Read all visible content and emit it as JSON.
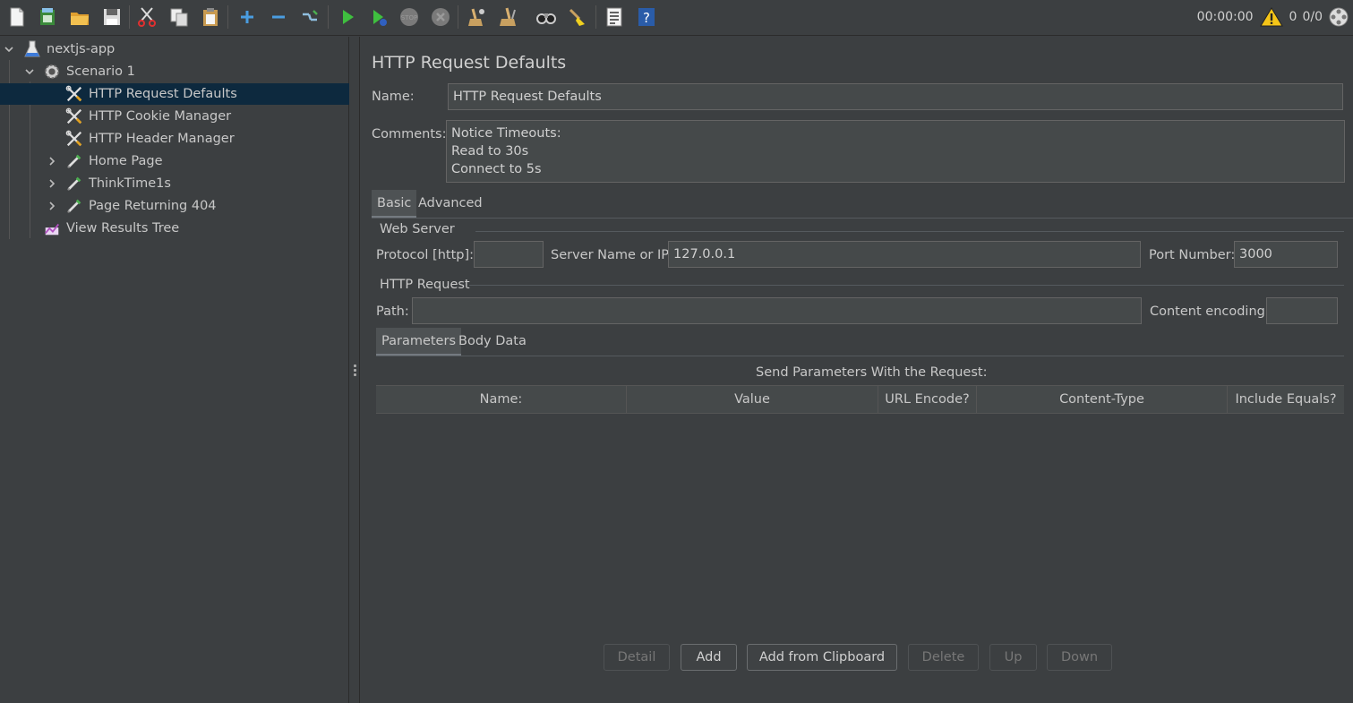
{
  "toolbar": {
    "icons": [
      "new-icon",
      "templates-icon",
      "open-icon",
      "save-icon",
      "cut-icon",
      "copy-icon",
      "paste-icon",
      "expand-icon",
      "collapse-icon",
      "toggle-icon",
      "start-icon",
      "start-no-pauses-icon",
      "stop-icon",
      "shutdown-icon",
      "clear-icon",
      "clear-all-icon",
      "search-icon",
      "reset-search-icon",
      "function-helper-icon",
      "help-icon"
    ],
    "timer": "00:00:00",
    "warnings": "0",
    "threads": "0/0"
  },
  "tree": {
    "items": [
      {
        "label": "nextjs-app",
        "icon": "test-plan-icon"
      },
      {
        "label": "Scenario 1",
        "icon": "thread-group-icon"
      },
      {
        "label": "HTTP Request Defaults",
        "icon": "config-element-icon"
      },
      {
        "label": "HTTP Cookie Manager",
        "icon": "config-element-icon"
      },
      {
        "label": "HTTP Header Manager",
        "icon": "config-element-icon"
      },
      {
        "label": "Home Page",
        "icon": "sampler-icon"
      },
      {
        "label": "ThinkTime1s",
        "icon": "sampler-icon"
      },
      {
        "label": "Page Returning 404",
        "icon": "sampler-icon"
      },
      {
        "label": "View Results Tree",
        "icon": "listener-icon"
      }
    ]
  },
  "main": {
    "title": "HTTP Request Defaults",
    "name_label": "Name:",
    "name_value": "HTTP Request Defaults",
    "comments_label": "Comments:",
    "comments_lines": [
      "Notice Timeouts:",
      "Read to 30s",
      "Connect to 5s"
    ],
    "tabs": [
      "Basic",
      "Advanced"
    ],
    "web_server": {
      "section": "Web Server",
      "protocol_label": "Protocol [http]:",
      "protocol_value": "",
      "server_label": "Server Name or IP:",
      "server_value": "127.0.0.1",
      "port_label": "Port Number:",
      "port_value": "3000"
    },
    "http_request": {
      "section": "HTTP Request",
      "path_label": "Path:",
      "path_value": "",
      "encoding_label": "Content encoding:",
      "encoding_value": ""
    },
    "sub_tabs": [
      "Parameters",
      "Body Data"
    ],
    "params_caption": "Send Parameters With the Request:",
    "columns": [
      "Name:",
      "Value",
      "URL Encode?",
      "Content-Type",
      "Include Equals?"
    ],
    "buttons": {
      "detail": "Detail",
      "add": "Add",
      "add_clipboard": "Add from Clipboard",
      "delete": "Delete",
      "up": "Up",
      "down": "Down"
    }
  }
}
